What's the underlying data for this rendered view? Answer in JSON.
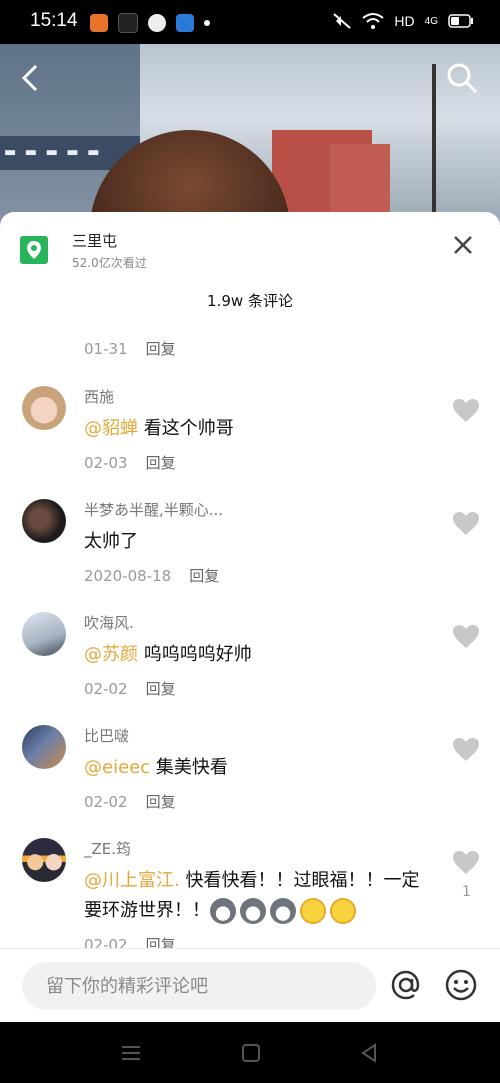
{
  "status_bar": {
    "time": "15:14",
    "network": "HD",
    "signal": "4G"
  },
  "location": {
    "title": "三里屯",
    "views": "52.0亿次看过"
  },
  "comment_count": "1.9w 条评论",
  "partial_comment": {
    "date": "01-31",
    "reply": "回复"
  },
  "comments": [
    {
      "username": "西施",
      "mention": "@貂蝉",
      "text": "看这个帅哥",
      "date": "02-03",
      "reply": "回复",
      "likes": ""
    },
    {
      "username": "半梦あ半醒,半颗心...",
      "mention": "",
      "text": "太帅了",
      "date": "2020-08-18",
      "reply": "回复",
      "likes": ""
    },
    {
      "username": "吹海风.",
      "mention": "@苏颜",
      "text": "呜呜呜呜好帅",
      "date": "02-02",
      "reply": "回复",
      "likes": ""
    },
    {
      "username": "比巴啵",
      "mention": "@eieec",
      "text": "集美快看",
      "date": "02-02",
      "reply": "回复",
      "likes": ""
    },
    {
      "username": "_ZE.筠",
      "mention": "@川上富江.",
      "text": "快看快看！！过眼福！！一定要环游世界！！",
      "date": "02-02",
      "reply": "回复",
      "likes": "1"
    }
  ],
  "input": {
    "placeholder": "留下你的精彩评论吧"
  },
  "colors": {
    "accent": "#e2a83a",
    "location_green": "#27b45b"
  }
}
